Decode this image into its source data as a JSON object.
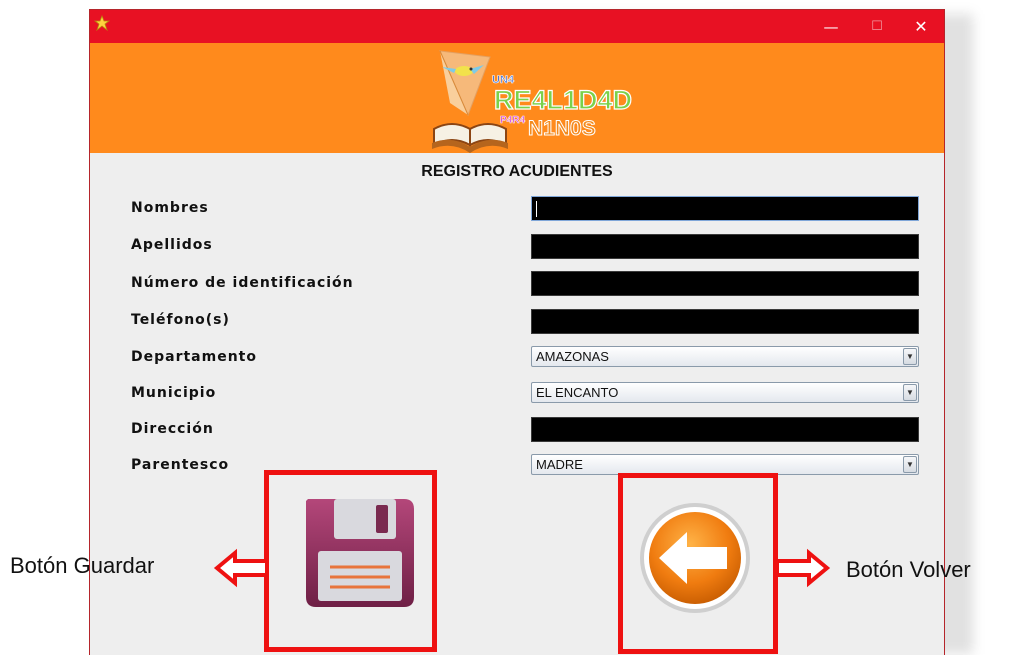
{
  "window": {
    "controls": {
      "minimize": "—",
      "maximize": "☐",
      "close": "✕"
    }
  },
  "banner": {
    "logo_text": {
      "line1": "UN4",
      "line2": "RE4L1D4D",
      "line3a": "P4R4",
      "line3b": "N1N0S"
    }
  },
  "form": {
    "title": "REGISTRO ACUDIENTES",
    "fields": [
      {
        "label": "Nombres",
        "type": "text",
        "value": ""
      },
      {
        "label": "Apellidos",
        "type": "text",
        "value": ""
      },
      {
        "label": "Número de identificación",
        "type": "text",
        "value": ""
      },
      {
        "label": "Teléfono(s)",
        "type": "text",
        "value": ""
      },
      {
        "label": "Departamento",
        "type": "select",
        "value": "AMAZONAS"
      },
      {
        "label": "Municipio",
        "type": "select",
        "value": "EL ENCANTO"
      },
      {
        "label": "Dirección",
        "type": "text",
        "value": ""
      },
      {
        "label": "Parentesco",
        "type": "select",
        "value": "MADRE"
      }
    ]
  },
  "callouts": {
    "save": "Botón Guardar",
    "back": "Botón Volver"
  },
  "colors": {
    "titlebar": "#e81123",
    "banner": "#ff8a1c",
    "highlight": "#ee1111"
  },
  "icons": {
    "save": "floppy-disk-icon",
    "back": "arrow-left-icon"
  }
}
